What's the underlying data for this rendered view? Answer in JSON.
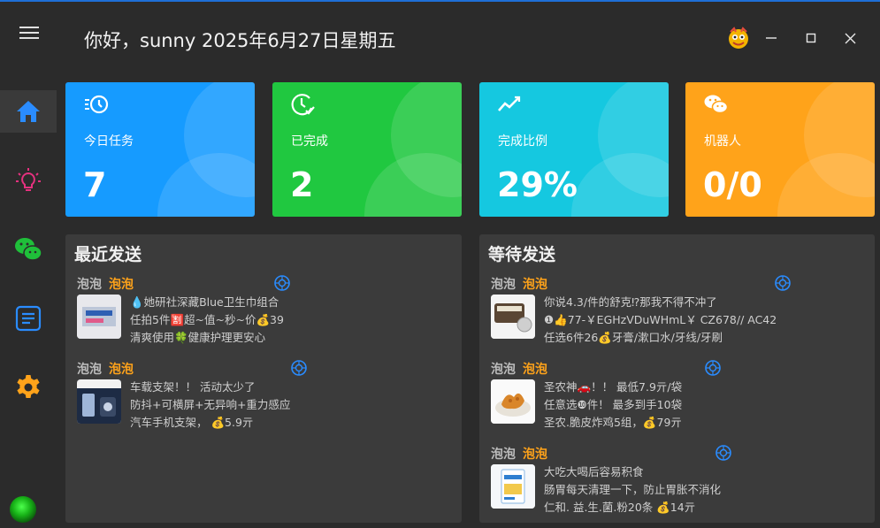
{
  "header": {
    "greeting": "你好，sunny 2025年6月27日星期五",
    "window_controls": [
      "minimize-icon",
      "maximize-icon",
      "close-icon"
    ]
  },
  "sidebar": {
    "items": [
      {
        "icon": "home-icon",
        "color": "#2a8cff",
        "active": true
      },
      {
        "icon": "lightbulb-icon",
        "color": "#e6317f",
        "active": false
      },
      {
        "icon": "wechat-icon",
        "color": "#1fbf3a",
        "active": false
      },
      {
        "icon": "document-icon",
        "color": "#2a8cff",
        "active": false
      },
      {
        "icon": "gear-icon",
        "color": "#ffa31a",
        "active": false
      }
    ],
    "status_color": "#1fc41f"
  },
  "stats": [
    {
      "label": "今日任务",
      "value": "7",
      "icon": "clock-history-icon",
      "color": "#169bff"
    },
    {
      "label": "已完成",
      "value": "2",
      "icon": "clock-check-icon",
      "color": "#20c840"
    },
    {
      "label": "完成比例",
      "value": "29%",
      "icon": "trend-line-icon",
      "color": "#15c8e0"
    },
    {
      "label": "机器人",
      "value": "0/0",
      "icon": "wechat-icon",
      "color": "#ffa31a"
    }
  ],
  "recent": {
    "title": "最近发送",
    "messages": [
      {
        "sender": "泡泡",
        "bot": "泡泡",
        "lines": [
          "💧她研社深藏Blue卫生巾组合",
          "任拍5件🈹超~值~秒~价💰39",
          "清爽使用🍀健康护理更安心"
        ]
      },
      {
        "sender": "泡泡",
        "bot": "泡泡",
        "lines": [
          "车载支架！！ 活动太少了",
          "防抖+可横屏+无异响+重力感应",
          "汽车手机支架，  💰5.9亓"
        ]
      }
    ]
  },
  "pending": {
    "title": "等待发送",
    "messages": [
      {
        "sender": "泡泡",
        "bot": "泡泡",
        "lines": [
          "你说4.3/件的舒克⁉那我不得不冲了",
          "❶👍77-￥EGHzVDuWHmL￥ CZ678// AC42",
          "任选6件26💰牙膏/漱口水/牙线/牙刷"
        ]
      },
      {
        "sender": "泡泡",
        "bot": "泡泡",
        "lines": [
          "圣农神🚗！！ 最低7.9亓/袋",
          "任意选❿件！ 最多到手10袋",
          "圣农.脆皮炸鸡5组，💰79亓"
        ]
      },
      {
        "sender": "泡泡",
        "bot": "泡泡",
        "lines": [
          "大吃大喝后容易积食",
          "肠胃每天清理一下，防止胃胀不消化",
          "仁和. 益.生.菌.粉20条 💰14亓"
        ]
      }
    ]
  },
  "colors": {
    "accent": "#169bff",
    "bot_name": "#ffa31a",
    "panel_bg": "#3b3b3b",
    "app_bg": "#2b2b2b"
  }
}
